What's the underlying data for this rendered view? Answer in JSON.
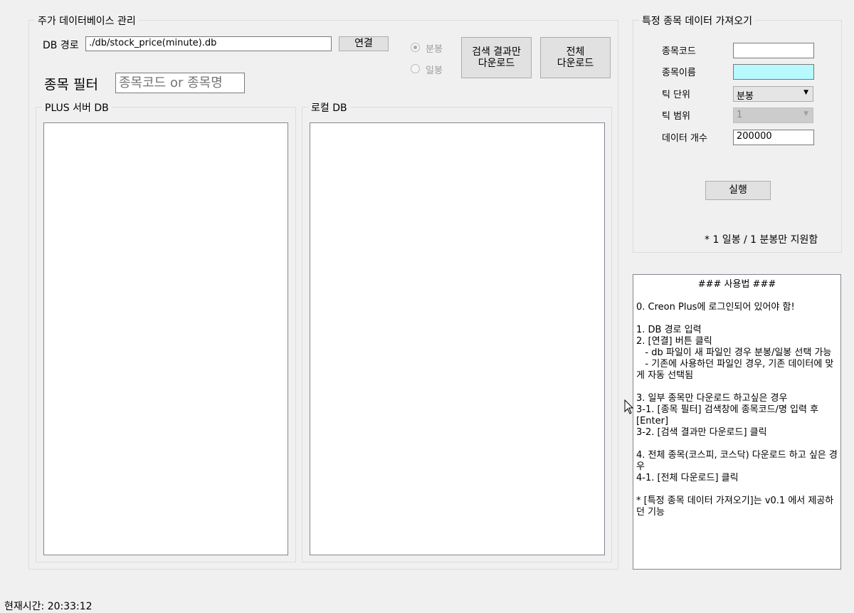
{
  "db_group": {
    "title": "주가 데이터베이스 관리",
    "db_path_label": "DB 경로",
    "db_path_value": "./db/stock_price(minute).db",
    "connect_button": "연결",
    "radio_minute": "분봉",
    "radio_day": "일봉",
    "download_search_button": [
      "검색 결과만",
      "다운로드"
    ],
    "download_all_button": [
      "전체",
      "다운로드"
    ],
    "filter_label": "종목 필터",
    "filter_placeholder": "종목코드 or 종목명",
    "server_db_title": "PLUS 서버 DB",
    "local_db_title": "로컬 DB"
  },
  "fetch_group": {
    "title": "특정 종목 데이터 가져오기",
    "code_label": "종목코드",
    "code_value": "",
    "name_label": "종목이름",
    "name_value": "",
    "tick_unit_label": "틱 단위",
    "tick_unit_value": "분봉",
    "tick_range_label": "틱 범위",
    "tick_range_value": "1",
    "count_label": "데이터 개수",
    "count_value": "200000",
    "run_button": "실행",
    "note": "* 1 일봉 / 1 분봉만 지원함"
  },
  "usage": {
    "title": "### 사용법 ###",
    "body": "0. Creon Plus에 로그인되어 있어야 함!\n\n1. DB 경로 입력\n2. [연결] 버튼 클릭\n   - db 파일이 새 파일인 경우 분봉/일봉 선택 가능\n   - 기존에 사용하던 파일인 경우, 기존 데이터에 맞게 자동 선택됨\n\n3. 일부 종목만 다운로드 하고싶은 경우\n3-1. [종목 필터] 검색창에 종목코드/명 입력 후 [Enter]\n3-2. [검색 결과만 다운로드] 클릭\n\n4. 전체 종목(코스피, 코스닥) 다운로드 하고 싶은 경우\n4-1. [전체 다운로드] 클릭\n\n* [특정 종목 데이터 가져오기]는 v0.1 에서 제공하던 기능"
  },
  "status": {
    "label": "현재시간:",
    "time": "20:33:12"
  },
  "colors": {
    "name_field_bg": "#b8f8ff"
  }
}
